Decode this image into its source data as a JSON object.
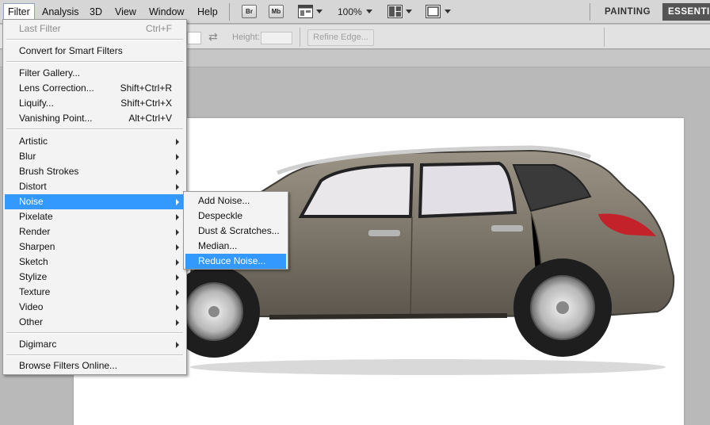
{
  "menubar": {
    "items": [
      "Filter",
      "Analysis",
      "3D",
      "View",
      "Window",
      "Help"
    ],
    "bridge_badge": "Br",
    "minibridge_badge": "Mb",
    "zoom": "100%",
    "workspaces": [
      "PAINTING",
      "ESSENTIALS"
    ]
  },
  "options": {
    "height_label": "Height:",
    "refine_edge": "Refine Edge...",
    "swap_glyph": "⇄"
  },
  "filter_menu": {
    "last_filter": {
      "label": "Last Filter",
      "shortcut": "Ctrl+F"
    },
    "convert_smart": "Convert for Smart Filters",
    "group2": [
      {
        "label": "Filter Gallery...",
        "shortcut": ""
      },
      {
        "label": "Lens Correction...",
        "shortcut": "Shift+Ctrl+R"
      },
      {
        "label": "Liquify...",
        "shortcut": "Shift+Ctrl+X"
      },
      {
        "label": "Vanishing Point...",
        "shortcut": "Alt+Ctrl+V"
      }
    ],
    "submenus": [
      "Artistic",
      "Blur",
      "Brush Strokes",
      "Distort",
      "Noise",
      "Pixelate",
      "Render",
      "Sharpen",
      "Sketch",
      "Stylize",
      "Texture",
      "Video",
      "Other"
    ],
    "digimarc": "Digimarc",
    "browse_online": "Browse Filters Online..."
  },
  "noise_submenu": [
    "Add Noise...",
    "Despeckle",
    "Dust & Scratches...",
    "Median...",
    "Reduce Noise..."
  ],
  "colors": {
    "highlight": "#3399ff",
    "menubar_bg": "#d6d6d6",
    "workspace_active": "#555555"
  }
}
